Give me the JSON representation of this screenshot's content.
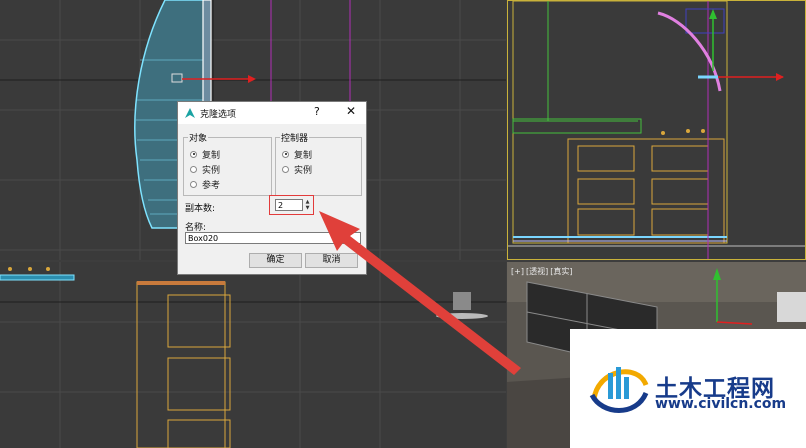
{
  "viewport_br": {
    "label_parts": [
      "[+]",
      "[透视]",
      "[真实]"
    ]
  },
  "dialog": {
    "title": "克隆选项",
    "help": "?",
    "close": "✕",
    "object_group": {
      "title": "对象",
      "options": [
        "复制",
        "实例",
        "参考"
      ],
      "selected": "复制"
    },
    "controller_group": {
      "title": "控制器",
      "options": [
        "复制",
        "实例"
      ],
      "selected": "复制"
    },
    "copies_label": "副本数:",
    "copies_value": "2",
    "name_label": "名称:",
    "name_value": "Box020",
    "ok_label": "确定",
    "cancel_label": "取消"
  },
  "watermark": {
    "name": "土木工程网",
    "url": "www.civilcn.com"
  },
  "colors": {
    "highlight": "#e23b3b",
    "arrow": "#e0403a",
    "brand": "#173b8a"
  }
}
